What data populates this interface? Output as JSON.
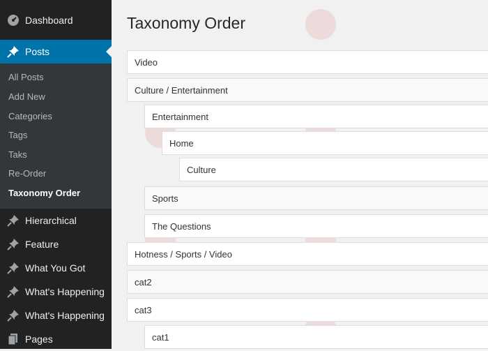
{
  "sidebar": {
    "top_items": [
      {
        "label": "Dashboard",
        "icon": "dashboard-icon"
      },
      {
        "label": "Posts",
        "icon": "pin-icon",
        "active": true
      }
    ],
    "submenu": [
      {
        "label": "All Posts"
      },
      {
        "label": "Add New"
      },
      {
        "label": "Categories"
      },
      {
        "label": "Tags"
      },
      {
        "label": "Taks"
      },
      {
        "label": "Re-Order"
      },
      {
        "label": "Taxonomy Order",
        "current": true
      }
    ],
    "bottom_items": [
      {
        "label": "Hierarchical",
        "icon": "pin-icon"
      },
      {
        "label": "Feature",
        "icon": "pin-icon"
      },
      {
        "label": "What You Got",
        "icon": "pin-icon"
      },
      {
        "label": "What's Happening",
        "icon": "pin-icon"
      },
      {
        "label": "What's Happening",
        "icon": "pin-icon"
      },
      {
        "label": "Pages",
        "icon": "pages-icon"
      }
    ]
  },
  "main": {
    "title": "Taxonomy Order",
    "terms": [
      {
        "label": "Video",
        "depth": 0
      },
      {
        "label": "Culture / Entertainment",
        "depth": 0
      },
      {
        "label": "Entertainment",
        "depth": 1
      },
      {
        "label": "Home",
        "depth": 2
      },
      {
        "label": "Culture",
        "depth": 3
      },
      {
        "label": "Sports",
        "depth": 1
      },
      {
        "label": "The Questions",
        "depth": 1
      },
      {
        "label": "Hotness / Sports / Video",
        "depth": 0
      },
      {
        "label": "cat2",
        "depth": 0
      },
      {
        "label": "cat3",
        "depth": 0
      },
      {
        "label": "cat1",
        "depth": 1
      }
    ]
  },
  "colors": {
    "sidebar_bg": "#222222",
    "submenu_bg": "#32373c",
    "active_bg": "#0073aa",
    "page_bg": "#f1f1f1"
  }
}
